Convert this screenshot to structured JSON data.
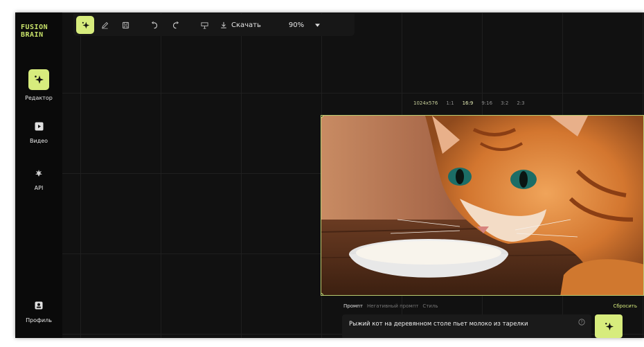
{
  "brand": {
    "logo_line1": "FUSION",
    "logo_line2": "BRAIN"
  },
  "sidebar": {
    "items": [
      {
        "label": "Редактор",
        "icon": "sparkle-icon",
        "active": true
      },
      {
        "label": "Видео",
        "icon": "video-icon",
        "active": false
      },
      {
        "label": "API",
        "icon": "api-icon",
        "active": false
      },
      {
        "label": "Профиль",
        "icon": "profile-icon",
        "active": false
      }
    ]
  },
  "toolbar": {
    "download_label": "Скачать",
    "zoom_value": "90%"
  },
  "aspect": {
    "resolution": "1024x576",
    "options": [
      "1:1",
      "16:9",
      "9:16",
      "3:2",
      "2:3"
    ],
    "selected": "16:9"
  },
  "prompt": {
    "tabs": [
      "Промпт",
      "Негативный промпт",
      "Стиль"
    ],
    "active_tab": "Промпт",
    "reset_label": "Сбросить",
    "text": "Рыжий кот на деревянном столе пьет молоко из тарелки"
  },
  "colors": {
    "accent": "#d7ec7d",
    "background": "#0d0d0d"
  }
}
